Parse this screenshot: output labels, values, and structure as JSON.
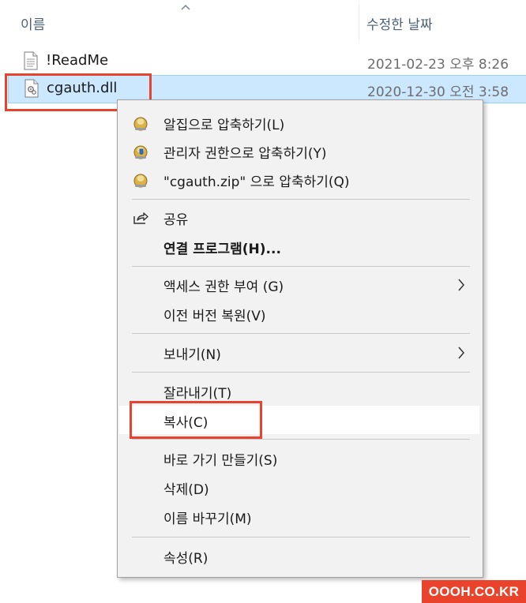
{
  "explorer": {
    "columns": {
      "name": "이름",
      "date": "수정한 날짜"
    },
    "files": [
      {
        "name": "!ReadMe",
        "date": "2021-02-23 오후 8:26",
        "icon": "text-file-icon"
      },
      {
        "name": "cgauth.dll",
        "date": "2020-12-30 오전 3:58",
        "icon": "dll-file-icon",
        "selected": true
      }
    ]
  },
  "context_menu": {
    "items": [
      {
        "label": "알집으로 압축하기(L)",
        "icon": "alzip-icon"
      },
      {
        "label": "관리자 권한으로 압축하기(Y)",
        "icon": "alzip-admin-icon"
      },
      {
        "label": "\"cgauth.zip\" 으로 압축하기(Q)",
        "icon": "alzip-icon"
      },
      {
        "label": "공유",
        "icon": "share-icon"
      },
      {
        "label": "연결 프로그램(H)..."
      },
      {
        "label": "액세스 권한 부여 (G)",
        "submenu": true
      },
      {
        "label": "이전 버전 복원(V)"
      },
      {
        "label": "보내기(N)",
        "submenu": true
      },
      {
        "label": "잘라내기(T)"
      },
      {
        "label": "복사(C)",
        "highlighted": true
      },
      {
        "label": "바로 가기 만들기(S)"
      },
      {
        "label": "삭제(D)"
      },
      {
        "label": "이름 바꾸기(M)"
      },
      {
        "label": "속성(R)"
      }
    ]
  },
  "watermark": "OOOH.CO.KR",
  "colors": {
    "selection_bg": "#cce8ff",
    "selection_border": "#99d1ff",
    "highlight_box": "#e7432f",
    "menu_bg": "#f2f2f2",
    "header_text": "#4c607a"
  }
}
